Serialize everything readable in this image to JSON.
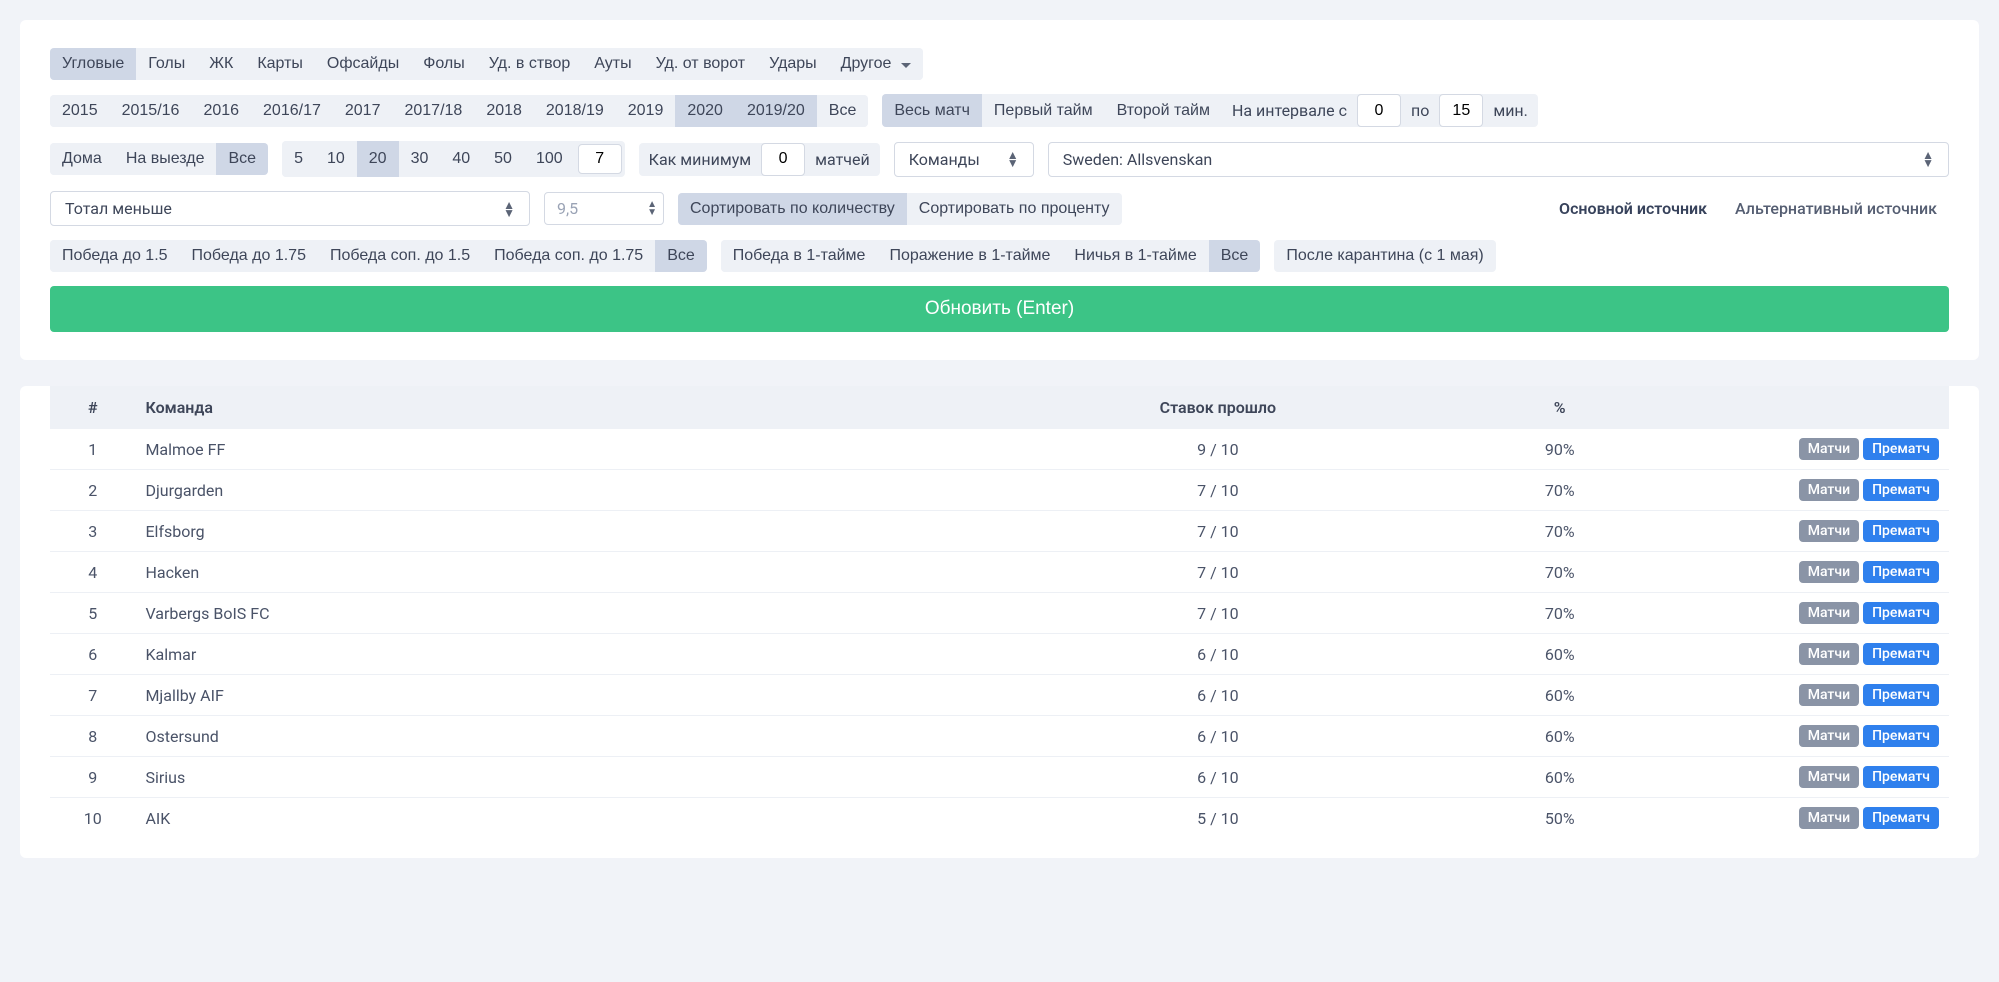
{
  "tabs": {
    "items": [
      "Угловые",
      "Голы",
      "ЖК",
      "Карты",
      "Офсайды",
      "Фолы",
      "Уд. в створ",
      "Ауты",
      "Уд. от ворот",
      "Удары",
      "Другое"
    ],
    "active": 0,
    "dropdown_index": 10
  },
  "seasons": {
    "items": [
      "2015",
      "2015/16",
      "2016",
      "2016/17",
      "2017",
      "2017/18",
      "2018",
      "2018/19",
      "2019",
      "2020",
      "2019/20",
      "Все"
    ],
    "active": [
      9,
      10
    ]
  },
  "match_period": {
    "items": [
      "Весь матч",
      "Первый тайм",
      "Второй тайм"
    ],
    "interval_label_prefix": "На интервале с",
    "interval_from": "0",
    "interval_label_mid": "по",
    "interval_to": "15",
    "interval_label_suffix": "мин.",
    "active": 0
  },
  "venue": {
    "items": [
      "Дома",
      "На выезде",
      "Все"
    ],
    "active": 2
  },
  "counts": {
    "items": [
      "5",
      "10",
      "20",
      "30",
      "40",
      "50",
      "100"
    ],
    "active": 2,
    "custom": "7"
  },
  "min_matches": {
    "prefix": "Как минимум",
    "value": "0",
    "suffix": "матчей"
  },
  "teams_label": "Команды",
  "league": "Sweden: Allsvenskan",
  "total_select": "Тотал меньше",
  "total_value_placeholder": "9,5",
  "sort": {
    "by_count": "Сортировать по количеству",
    "by_percent": "Сортировать по проценту",
    "active": 0
  },
  "source": {
    "main": "Основной источник",
    "alt": "Альтернативный источник",
    "active": 0
  },
  "wins": {
    "items": [
      "Победа до 1.5",
      "Победа до 1.75",
      "Победа соп. до 1.5",
      "Победа соп. до 1.75",
      "Все"
    ],
    "active": 4
  },
  "half_results": {
    "items": [
      "Победа в 1-тайме",
      "Поражение в 1-тайме",
      "Ничья в 1-тайме",
      "Все"
    ],
    "active": 3
  },
  "quarantine": "После карантина (с 1 мая)",
  "update_button": "Обновить (Enter)",
  "table": {
    "headers": {
      "num": "#",
      "team": "Команда",
      "bets": "Ставок прошло",
      "pct": "%"
    },
    "action_labels": {
      "matches": "Матчи",
      "prematch": "Прематч"
    },
    "rows": [
      {
        "n": "1",
        "team": "Malmoe FF",
        "bets": "9 / 10",
        "pct": "90%"
      },
      {
        "n": "2",
        "team": "Djurgarden",
        "bets": "7 / 10",
        "pct": "70%"
      },
      {
        "n": "3",
        "team": "Elfsborg",
        "bets": "7 / 10",
        "pct": "70%"
      },
      {
        "n": "4",
        "team": "Hacken",
        "bets": "7 / 10",
        "pct": "70%"
      },
      {
        "n": "5",
        "team": "Varbergs BoIS FC",
        "bets": "7 / 10",
        "pct": "70%"
      },
      {
        "n": "6",
        "team": "Kalmar",
        "bets": "6 / 10",
        "pct": "60%"
      },
      {
        "n": "7",
        "team": "Mjallby AIF",
        "bets": "6 / 10",
        "pct": "60%"
      },
      {
        "n": "8",
        "team": "Ostersund",
        "bets": "6 / 10",
        "pct": "60%"
      },
      {
        "n": "9",
        "team": "Sirius",
        "bets": "6 / 10",
        "pct": "60%"
      },
      {
        "n": "10",
        "team": "AIK",
        "bets": "5 / 10",
        "pct": "50%"
      }
    ]
  }
}
